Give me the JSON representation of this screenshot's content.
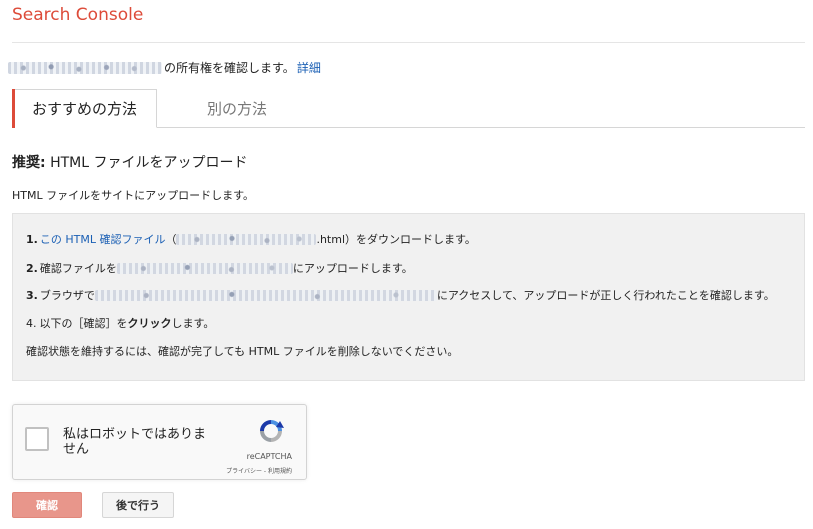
{
  "app_title": "Search Console",
  "ownership": {
    "text": "の所有権を確認します。",
    "details_link": "詳細"
  },
  "tabs": [
    {
      "label": "おすすめの方法",
      "active": true
    },
    {
      "label": "別の方法",
      "active": false
    }
  ],
  "recommended": {
    "label": "推奨:",
    "title": "HTML ファイルをアップロード",
    "subtitle": "HTML ファイルをサイトにアップロードします。"
  },
  "steps": {
    "s1_num": "1.",
    "s1_link": "この HTML 確認ファイル",
    "s1_paren_open": "（",
    "s1_ext": ".html）",
    "s1_rest": "をダウンロードします。",
    "s2_num": "2.",
    "s2_pre": "確認ファイルを",
    "s2_post": "にアップロードします。",
    "s3_num": "3.",
    "s3_pre": "ブラウザで",
    "s3_post": "にアクセスして、アップロードが正しく行われたことを確認します。",
    "s4_num": "4.",
    "s4_pre": "以下の［確認］を",
    "s4_bold": "クリック",
    "s4_post": "します。",
    "note": "確認状態を維持するには、確認が完了しても HTML ファイルを削除しないでください。"
  },
  "captcha": {
    "label": "私はロボットではありません",
    "brand": "reCAPTCHA",
    "terms": "プライバシー - 利用規約",
    "checked": false
  },
  "buttons": {
    "confirm": "確認",
    "later": "後で行う"
  },
  "colors": {
    "accent": "#dd4b39",
    "link": "#1a5fb4",
    "confirm_button": "#e8968b"
  }
}
